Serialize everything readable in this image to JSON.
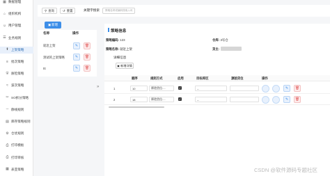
{
  "sidebar": {
    "items": [
      {
        "label": "数据管理",
        "icon": "grid-icon",
        "active": false,
        "sub": false
      },
      {
        "label": "组织机构",
        "icon": "org-icon",
        "active": false,
        "sub": false
      },
      {
        "label": "用户管理",
        "icon": "user-icon",
        "active": false,
        "sub": false
      },
      {
        "label": "业务规则",
        "icon": "rules-icon",
        "active": false,
        "sub": false
      },
      {
        "label": "上架策略",
        "icon": "shelf-icon",
        "active": true,
        "sub": true
      },
      {
        "label": "批次策略",
        "icon": "batch-icon",
        "active": false,
        "sub": true
      },
      {
        "label": "质检策略",
        "icon": "shield-icon",
        "active": false,
        "sub": true
      },
      {
        "label": "波次策略",
        "icon": "wave-icon",
        "active": false,
        "sub": true
      },
      {
        "label": "SO拆分策略",
        "icon": "split-icon",
        "active": false,
        "sub": true
      },
      {
        "label": "静线规则",
        "icon": "line-icon",
        "active": false,
        "sub": true
      },
      {
        "label": "库存策略规则",
        "icon": "stock-icon",
        "active": false,
        "sub": true
      },
      {
        "label": "仓优规则",
        "icon": "optimize-icon",
        "active": false,
        "sub": true
      },
      {
        "label": "打印模板",
        "icon": "print-icon",
        "active": false,
        "sub": true
      },
      {
        "label": "打印审核",
        "icon": "print-review-icon",
        "active": false,
        "sub": true
      },
      {
        "label": "表亚策略",
        "icon": "table-icon",
        "active": false,
        "sub": true
      }
    ]
  },
  "search": {
    "query_label": "查询",
    "reset_label": "重置",
    "keyword_label": "关键字搜索",
    "keyword_placeholder": "策略名称或编码搜索入司"
  },
  "add_button": {
    "label": "新增"
  },
  "strategy_list": {
    "headers": {
      "name": "名称",
      "action": "操作"
    },
    "rows": [
      {
        "name": "就近上架"
      },
      {
        "name": "测试的上架策略"
      },
      {
        "name": "ttt"
      }
    ]
  },
  "detail": {
    "title": "策略信息",
    "code_label": "策略编码:",
    "code_value": "123",
    "warehouse_label": "仓库:",
    "warehouse_value": "3号仓",
    "name_label": "策略名称:",
    "name_value": "就近上架",
    "owner_label": "货主:",
    "section_label": "详细信息",
    "add_detail_label": "新增详情",
    "table": {
      "headers": [
        "顺序",
        "规则方式",
        "启用",
        "目标库区",
        "源验货位",
        "操作"
      ],
      "rows": [
        {
          "index": "1",
          "order": "10",
          "method": "原验货位-...",
          "enabled": true,
          "target_zone": "--"
        },
        {
          "index": "2",
          "order": "18",
          "method": "原验货位-...",
          "enabled": true,
          "target_zone": "--"
        }
      ]
    }
  },
  "watermark": "CSDN @软件源码专题社区",
  "colors": {
    "accent": "#3d8ee8",
    "danger": "#e05454",
    "active_bg": "#e8f0fb"
  }
}
